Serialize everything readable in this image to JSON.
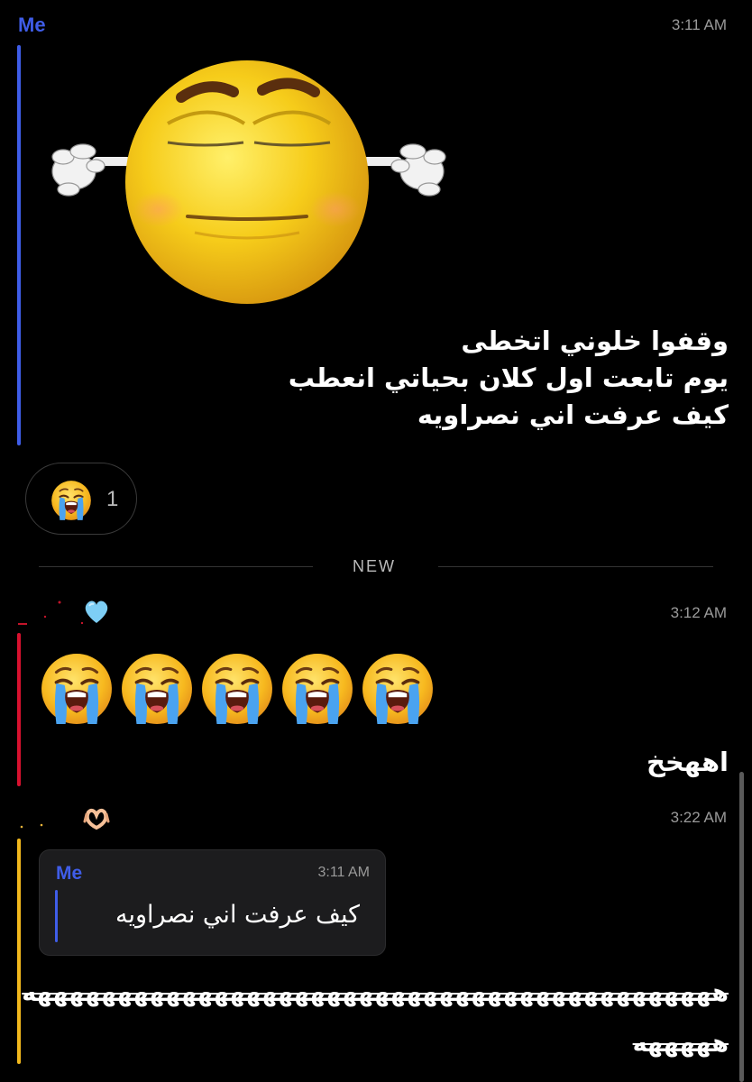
{
  "colors": {
    "me_accent": "#3f5de8",
    "other_accent": "#d8112f",
    "third_accent": "#f1b81d",
    "background": "#000000"
  },
  "messages": [
    {
      "sender": "Me",
      "time": "3:11 AM",
      "sticker": "ear-covering-emoji-sticker",
      "text_lines": [
        "وقفوا خلوني اتخطى",
        "يوم تابعت اول كلان بحياتي انعطب",
        "كيف عرفت اني نصراويه"
      ],
      "reaction": {
        "emoji": "loudly-crying-face",
        "count": "1"
      }
    },
    {
      "sender_badge": "light-blue-heart-icon",
      "time": "3:12 AM",
      "emojis": [
        "loudly-crying-face",
        "loudly-crying-face",
        "loudly-crying-face",
        "loudly-crying-face",
        "loudly-crying-face"
      ],
      "text": "اههخخ"
    },
    {
      "sender_badge": "heart-hands-icon",
      "time": "3:22 AM",
      "quote": {
        "sender": "Me",
        "time": "3:11 AM",
        "text": "كيف عرفت اني نصراويه"
      },
      "text_line1": "هههههههههههههههههههههههههههههههههههههههههههه",
      "text_line2": "هههههه"
    }
  ],
  "divider_label": "NEW"
}
